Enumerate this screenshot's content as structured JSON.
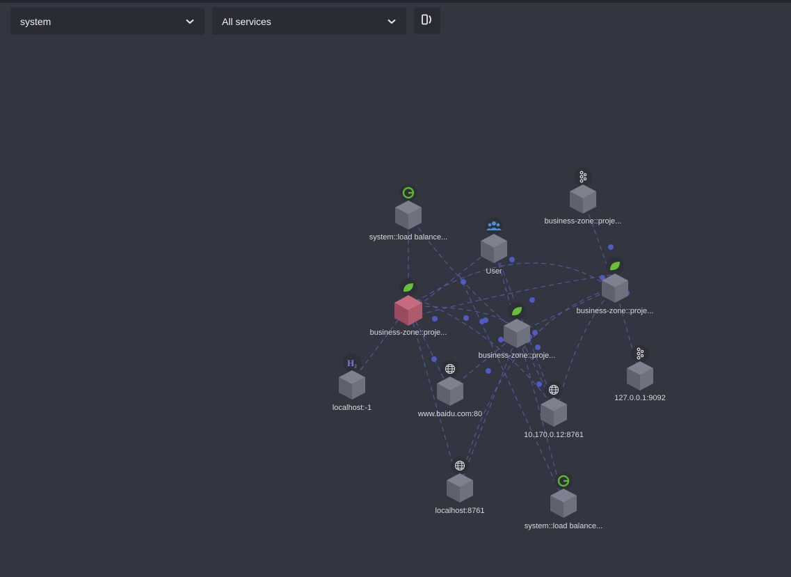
{
  "toolbar": {
    "group_value": "system",
    "service_value": "All services"
  },
  "colors": {
    "background": "#333540",
    "edge": "#4f5a9e",
    "highlight_node": "#b85a6e",
    "spring_green": "#6abf3a"
  },
  "nodes": [
    {
      "id": "n1",
      "label": "system::load balance...",
      "icon": "gateway-icon"
    },
    {
      "id": "n2",
      "label": "User",
      "icon": "users-icon"
    },
    {
      "id": "n3",
      "label": "business-zone::proje...",
      "icon": "kafka-icon"
    },
    {
      "id": "n4",
      "label": "business-zone::proje...",
      "icon": "spring-icon"
    },
    {
      "id": "n5",
      "label": "business-zone::proje...",
      "icon": "spring-icon"
    },
    {
      "id": "n6",
      "label": "business-zone::proje...",
      "icon": "spring-icon"
    },
    {
      "id": "n7",
      "label": "localhost:-1",
      "icon": "h2-icon"
    },
    {
      "id": "n8",
      "label": "www.baidu.com:80",
      "icon": "globe-icon"
    },
    {
      "id": "n9",
      "label": "127.0.0.1:9092",
      "icon": "kafka-icon"
    },
    {
      "id": "n10",
      "label": "10.170.0.12:8761",
      "icon": "globe-icon"
    },
    {
      "id": "n11",
      "label": "localhost:8761",
      "icon": "globe-icon"
    },
    {
      "id": "n12",
      "label": "system::load balance...",
      "icon": "gateway-icon"
    }
  ]
}
